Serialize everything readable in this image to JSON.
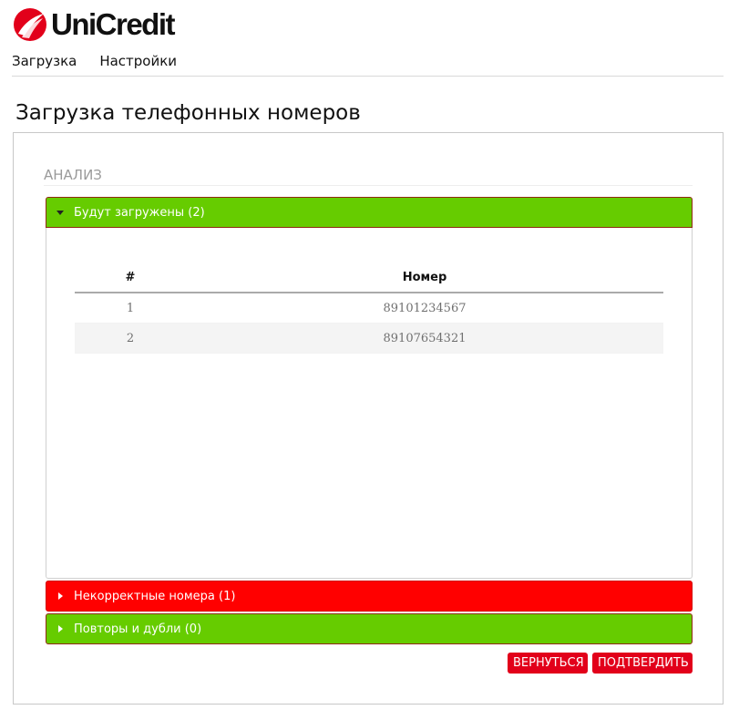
{
  "brand": {
    "name": "UniCredit",
    "color": "#e2001a"
  },
  "nav": {
    "items": [
      {
        "label": "Загрузка"
      },
      {
        "label": "Настройки"
      }
    ]
  },
  "page": {
    "title": "Загрузка телефонных номеров"
  },
  "analysis": {
    "title": "АНАЛИЗ",
    "sections": [
      {
        "label": "Будут загружены (2)",
        "state": "expanded",
        "color": "#66cc00"
      },
      {
        "label": "Некорректные номера (1)",
        "state": "collapsed",
        "color": "#ff0000"
      },
      {
        "label": "Повторы и дубли (0)",
        "state": "collapsed",
        "color": "#66cc00"
      }
    ],
    "table": {
      "columns": [
        "#",
        "Номер"
      ],
      "rows": [
        [
          "1",
          "89101234567"
        ],
        [
          "2",
          "89107654321"
        ]
      ]
    }
  },
  "actions": {
    "back_label": "ВЕРНУТЬСЯ",
    "confirm_label": "ПОДТВЕРДИТЬ"
  },
  "icons": {
    "logo": "unicredit-logo-icon",
    "expanded": "caret-down-icon",
    "collapsed": "caret-right-icon"
  }
}
